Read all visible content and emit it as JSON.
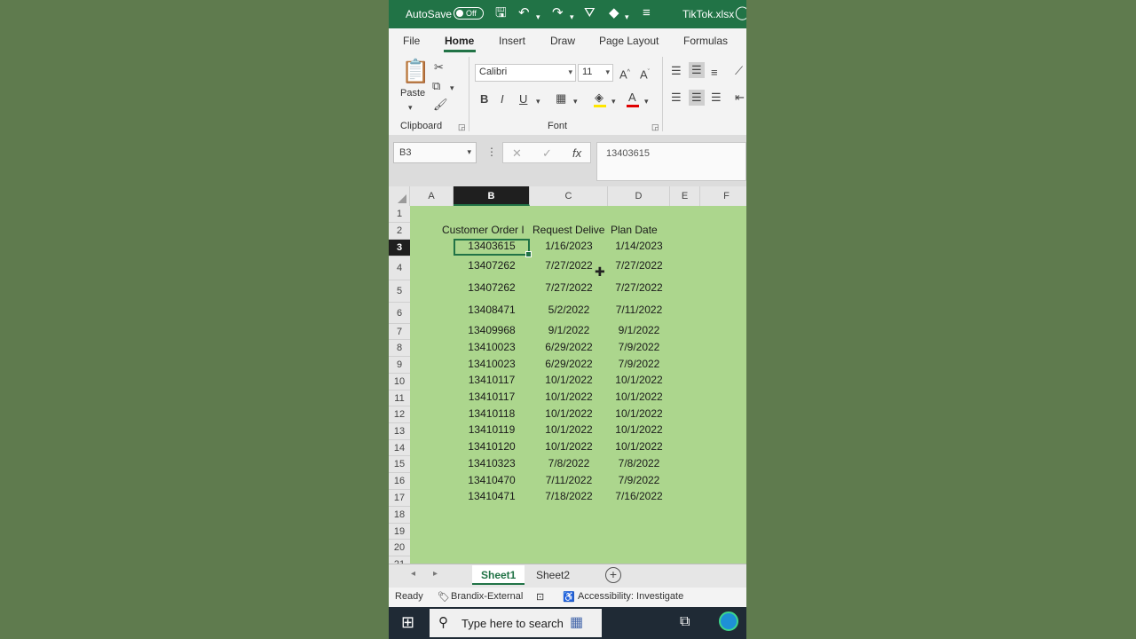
{
  "titlebar": {
    "autosave_label": "AutoSave",
    "autosave_state": "Off",
    "filename": "TikTok.xlsx"
  },
  "ribbon_tabs": [
    "File",
    "Home",
    "Insert",
    "Draw",
    "Page Layout",
    "Formulas"
  ],
  "active_tab": "Home",
  "clipboard": {
    "paste_label": "Paste",
    "group_label": "Clipboard"
  },
  "font": {
    "font_name": "Calibri",
    "font_size": "11",
    "group_label": "Font"
  },
  "formula_bar": {
    "name_box": "B3",
    "value": "13403615"
  },
  "columns": [
    "A",
    "B",
    "C",
    "D",
    "E",
    "F"
  ],
  "selected_column": "B",
  "rows": [
    "1",
    "2",
    "3",
    "4",
    "5",
    "6",
    "7",
    "8",
    "9",
    "10",
    "11",
    "12",
    "13",
    "14",
    "15",
    "16",
    "17",
    "18",
    "19",
    "20",
    "21"
  ],
  "selected_row": "3",
  "table": {
    "headers": [
      "Customer Order I",
      "Request Delive",
      "Plan Date"
    ],
    "data": [
      [
        "13403615",
        "1/16/2023",
        "1/14/2023"
      ],
      [
        "13407262",
        "7/27/2022",
        "7/27/2022"
      ],
      [
        "13407262",
        "7/27/2022",
        "7/27/2022"
      ],
      [
        "13408471",
        "5/2/2022",
        "7/11/2022"
      ],
      [
        "13409968",
        "9/1/2022",
        "9/1/2022"
      ],
      [
        "13410023",
        "6/29/2022",
        "7/9/2022"
      ],
      [
        "13410023",
        "6/29/2022",
        "7/9/2022"
      ],
      [
        "13410117",
        "10/1/2022",
        "10/1/2022"
      ],
      [
        "13410117",
        "10/1/2022",
        "10/1/2022"
      ],
      [
        "13410118",
        "10/1/2022",
        "10/1/2022"
      ],
      [
        "13410119",
        "10/1/2022",
        "10/1/2022"
      ],
      [
        "13410120",
        "10/1/2022",
        "10/1/2022"
      ],
      [
        "13410323",
        "7/8/2022",
        "7/8/2022"
      ],
      [
        "13410470",
        "7/11/2022",
        "7/9/2022"
      ],
      [
        "13410471",
        "7/18/2022",
        "7/16/2022"
      ]
    ]
  },
  "sheet_tabs": [
    "Sheet1",
    "Sheet2"
  ],
  "active_sheet": "Sheet1",
  "status": {
    "ready": "Ready",
    "label": "Brandix-External",
    "accessibility": "Accessibility: Investigate"
  },
  "taskbar": {
    "search_placeholder": "Type here to search"
  },
  "colors": {
    "excel_green": "#217346",
    "sheet_fill": "#acd68d",
    "backdrop": "#5f7b4e"
  }
}
